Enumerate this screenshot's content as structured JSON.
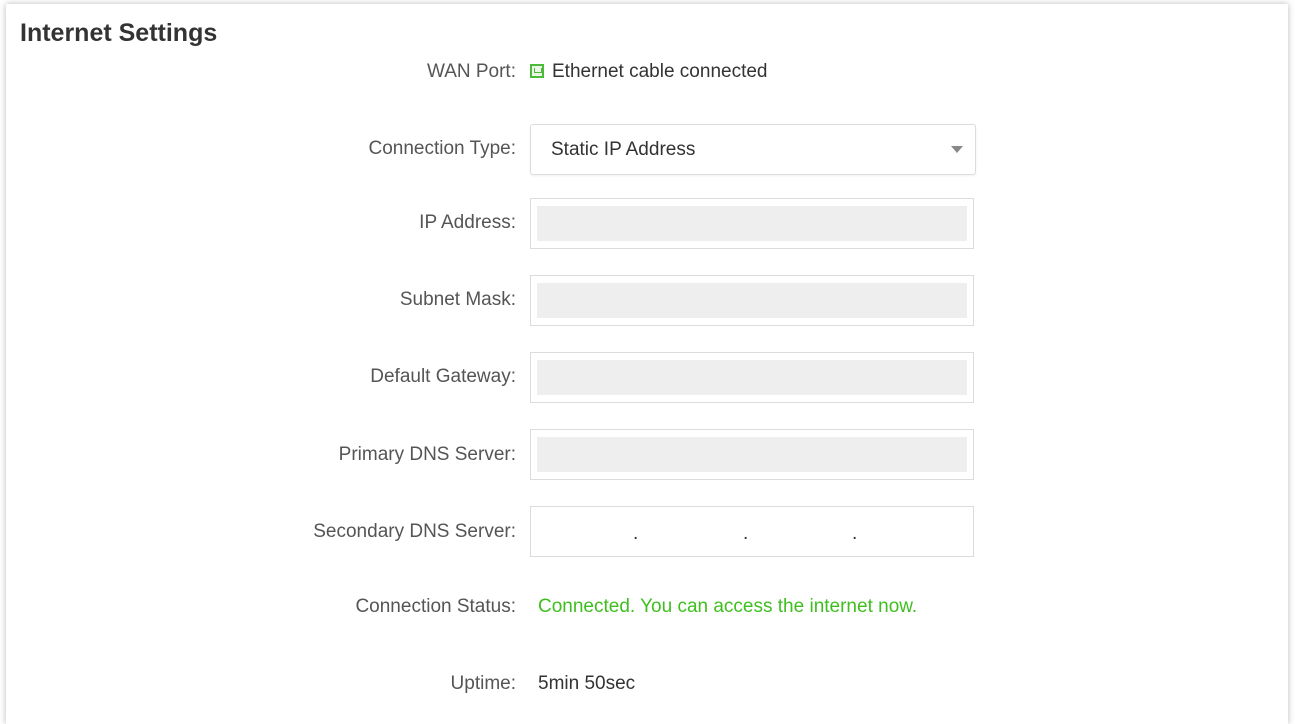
{
  "section": {
    "title": "Internet Settings"
  },
  "wan_port": {
    "label": "WAN Port:",
    "status_text": "Ethernet cable connected",
    "icon": "ethernet-port-icon"
  },
  "connection_type": {
    "label": "Connection Type:",
    "selected": "Static IP Address"
  },
  "ip_address": {
    "label": "IP Address:",
    "value": ""
  },
  "subnet_mask": {
    "label": "Subnet Mask:",
    "value": ""
  },
  "default_gateway": {
    "label": "Default Gateway:",
    "value": ""
  },
  "primary_dns": {
    "label": "Primary DNS Server:",
    "value": ""
  },
  "secondary_dns": {
    "label": "Secondary DNS Server:",
    "separator": "."
  },
  "connection_status": {
    "label": "Connection Status:",
    "text": "Connected. You can access the internet now.",
    "color": "#3fbf1f"
  },
  "uptime": {
    "label": "Uptime:",
    "value": "5min 50sec"
  }
}
